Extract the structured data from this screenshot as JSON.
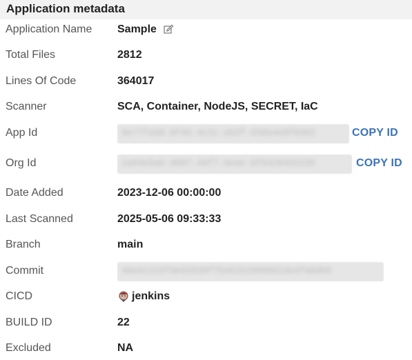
{
  "header": {
    "title": "Application metadata"
  },
  "rows": {
    "app_name": {
      "label": "Application Name",
      "value": "Sample"
    },
    "total_files": {
      "label": "Total Files",
      "value": "2812"
    },
    "loc": {
      "label": "Lines Of Code",
      "value": "364017"
    },
    "scanner": {
      "label": "Scanner",
      "value": "SCA, Container, NodeJS, SECRET, IaC"
    },
    "app_id": {
      "label": "App Id",
      "copy_label": "COPY ID"
    },
    "org_id": {
      "label": "Org Id",
      "copy_label": "COPY ID"
    },
    "date_added": {
      "label": "Date Added",
      "value": "2023-12-06 00:00:00"
    },
    "last_scanned": {
      "label": "Last Scanned",
      "value": "2025-05-06 09:33:33"
    },
    "branch": {
      "label": "Branch",
      "value": "main"
    },
    "commit": {
      "label": "Commit"
    },
    "cicd": {
      "label": "CICD",
      "value": "jenkins"
    },
    "build_id": {
      "label": "BUILD ID",
      "value": "22"
    },
    "excluded": {
      "label": "Excluded",
      "value": "NA"
    }
  },
  "icons": {
    "edit": "edit-icon",
    "jenkins": "jenkins-icon"
  },
  "colors": {
    "link": "#3b73b9",
    "header_bg": "#f2f2f2"
  }
}
